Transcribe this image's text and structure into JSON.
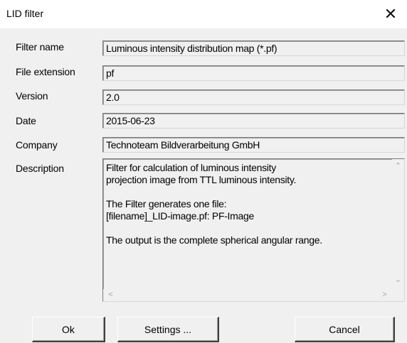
{
  "window": {
    "title": "LID filter",
    "close_glyph": "✕"
  },
  "fields": {
    "filter_name": {
      "label": "Filter name",
      "value": "Luminous intensity distribution map (*.pf)"
    },
    "file_extension": {
      "label": "File extension",
      "value": "pf"
    },
    "version": {
      "label": "Version",
      "value": "2.0"
    },
    "date": {
      "label": "Date",
      "value": "2015-06-23"
    },
    "company": {
      "label": "Company",
      "value": "Technoteam Bildverarbeitung GmbH"
    },
    "description": {
      "label": "Description",
      "value": "Filter for calculation of luminous intensity\nprojection image from TTL luminous intensity.\n\nThe Filter generates one file:\n[filename]_LID-image.pf: PF-Image\n\nThe output is the complete spherical angular range."
    }
  },
  "buttons": {
    "ok": "Ok",
    "settings": "Settings ...",
    "cancel": "Cancel"
  },
  "icons": {
    "close": "close-icon",
    "scroll_up": "chevron-up-icon",
    "scroll_down": "chevron-down-icon",
    "scroll_left": "chevron-left-icon",
    "scroll_right": "chevron-right-icon"
  }
}
